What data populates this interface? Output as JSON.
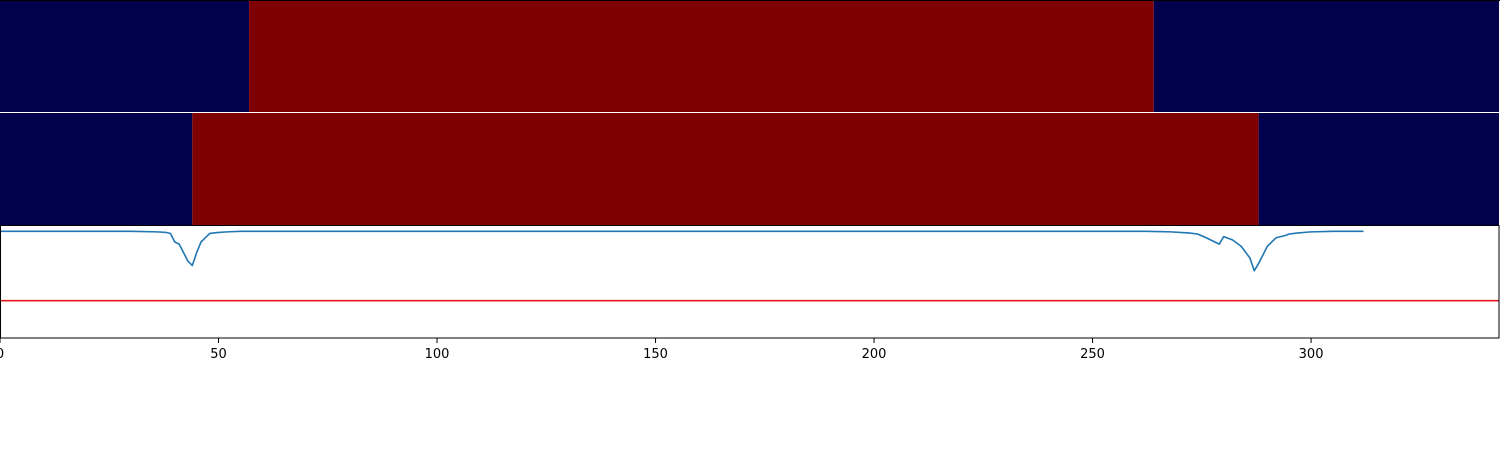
{
  "chart_data": {
    "type": "line",
    "xlim": [
      0,
      343
    ],
    "xticks": [
      0,
      50,
      100,
      150,
      200,
      250,
      300
    ],
    "xtick_labels": [
      "0",
      "50",
      "100",
      "150",
      "200",
      "250",
      "300"
    ],
    "grid": false,
    "legend": "none",
    "bands": [
      {
        "name": "band-top",
        "segments": [
          {
            "x0": 0,
            "x1": 57,
            "state": "low"
          },
          {
            "x0": 57,
            "x1": 264,
            "state": "high"
          },
          {
            "x0": 264,
            "x1": 343,
            "state": "low"
          }
        ]
      },
      {
        "name": "band-bottom",
        "segments": [
          {
            "x0": 0,
            "x1": 44,
            "state": "low"
          },
          {
            "x0": 44,
            "x1": 288,
            "state": "high"
          },
          {
            "x0": 288,
            "x1": 343,
            "state": "low"
          }
        ]
      }
    ],
    "series": [
      {
        "color": "#1f77b4",
        "ylim": [
          -1.0,
          0.05
        ],
        "points": [
          [
            0,
            0.0
          ],
          [
            10,
            0.0
          ],
          [
            20,
            0.0
          ],
          [
            30,
            0.0
          ],
          [
            36,
            -0.005
          ],
          [
            38,
            -0.01
          ],
          [
            39,
            -0.02
          ],
          [
            40,
            -0.1
          ],
          [
            41,
            -0.12
          ],
          [
            42,
            -0.2
          ],
          [
            43,
            -0.28
          ],
          [
            44,
            -0.32
          ],
          [
            45,
            -0.2
          ],
          [
            46,
            -0.1
          ],
          [
            47,
            -0.06
          ],
          [
            48,
            -0.02
          ],
          [
            50,
            -0.01
          ],
          [
            52,
            -0.005
          ],
          [
            55,
            0.0
          ],
          [
            80,
            0.0
          ],
          [
            120,
            0.0
          ],
          [
            160,
            0.0
          ],
          [
            200,
            0.0
          ],
          [
            240,
            0.0
          ],
          [
            262,
            0.0
          ],
          [
            265,
            -0.002
          ],
          [
            268,
            -0.005
          ],
          [
            270,
            -0.01
          ],
          [
            272,
            -0.015
          ],
          [
            274,
            -0.025
          ],
          [
            276,
            -0.06
          ],
          [
            278,
            -0.1
          ],
          [
            279,
            -0.12
          ],
          [
            280,
            -0.05
          ],
          [
            282,
            -0.08
          ],
          [
            284,
            -0.14
          ],
          [
            286,
            -0.25
          ],
          [
            287,
            -0.37
          ],
          [
            288,
            -0.3
          ],
          [
            290,
            -0.14
          ],
          [
            292,
            -0.06
          ],
          [
            294,
            -0.04
          ],
          [
            295,
            -0.025
          ],
          [
            297,
            -0.015
          ],
          [
            300,
            -0.005
          ],
          [
            305,
            0.0
          ],
          [
            312,
            0.0
          ]
        ]
      },
      {
        "color": "#e31a1c",
        "ylim": [
          -1.0,
          0.05
        ],
        "points": [
          [
            0,
            -0.65
          ],
          [
            343,
            -0.65
          ]
        ]
      }
    ],
    "colors": {
      "low": "#00004c",
      "high": "#7f0000",
      "line": "#1f77b4",
      "threshold": "#e31a1c",
      "separator": "#ffffff",
      "frame": "#000000"
    }
  }
}
